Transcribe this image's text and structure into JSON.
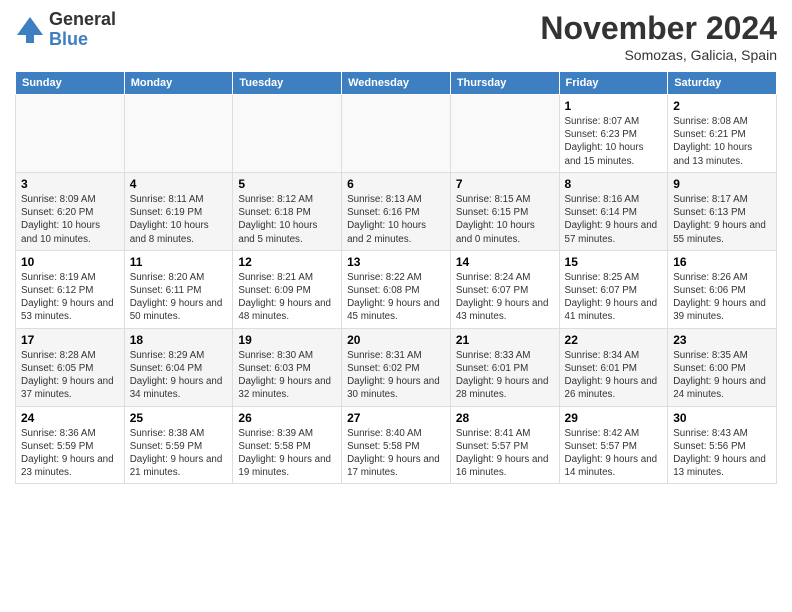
{
  "logo": {
    "general": "General",
    "blue": "Blue"
  },
  "header": {
    "month": "November 2024",
    "location": "Somozas, Galicia, Spain"
  },
  "weekdays": [
    "Sunday",
    "Monday",
    "Tuesday",
    "Wednesday",
    "Thursday",
    "Friday",
    "Saturday"
  ],
  "weeks": [
    [
      {
        "day": "",
        "info": ""
      },
      {
        "day": "",
        "info": ""
      },
      {
        "day": "",
        "info": ""
      },
      {
        "day": "",
        "info": ""
      },
      {
        "day": "",
        "info": ""
      },
      {
        "day": "1",
        "info": "Sunrise: 8:07 AM\nSunset: 6:23 PM\nDaylight: 10 hours and 15 minutes."
      },
      {
        "day": "2",
        "info": "Sunrise: 8:08 AM\nSunset: 6:21 PM\nDaylight: 10 hours and 13 minutes."
      }
    ],
    [
      {
        "day": "3",
        "info": "Sunrise: 8:09 AM\nSunset: 6:20 PM\nDaylight: 10 hours and 10 minutes."
      },
      {
        "day": "4",
        "info": "Sunrise: 8:11 AM\nSunset: 6:19 PM\nDaylight: 10 hours and 8 minutes."
      },
      {
        "day": "5",
        "info": "Sunrise: 8:12 AM\nSunset: 6:18 PM\nDaylight: 10 hours and 5 minutes."
      },
      {
        "day": "6",
        "info": "Sunrise: 8:13 AM\nSunset: 6:16 PM\nDaylight: 10 hours and 2 minutes."
      },
      {
        "day": "7",
        "info": "Sunrise: 8:15 AM\nSunset: 6:15 PM\nDaylight: 10 hours and 0 minutes."
      },
      {
        "day": "8",
        "info": "Sunrise: 8:16 AM\nSunset: 6:14 PM\nDaylight: 9 hours and 57 minutes."
      },
      {
        "day": "9",
        "info": "Sunrise: 8:17 AM\nSunset: 6:13 PM\nDaylight: 9 hours and 55 minutes."
      }
    ],
    [
      {
        "day": "10",
        "info": "Sunrise: 8:19 AM\nSunset: 6:12 PM\nDaylight: 9 hours and 53 minutes."
      },
      {
        "day": "11",
        "info": "Sunrise: 8:20 AM\nSunset: 6:11 PM\nDaylight: 9 hours and 50 minutes."
      },
      {
        "day": "12",
        "info": "Sunrise: 8:21 AM\nSunset: 6:09 PM\nDaylight: 9 hours and 48 minutes."
      },
      {
        "day": "13",
        "info": "Sunrise: 8:22 AM\nSunset: 6:08 PM\nDaylight: 9 hours and 45 minutes."
      },
      {
        "day": "14",
        "info": "Sunrise: 8:24 AM\nSunset: 6:07 PM\nDaylight: 9 hours and 43 minutes."
      },
      {
        "day": "15",
        "info": "Sunrise: 8:25 AM\nSunset: 6:07 PM\nDaylight: 9 hours and 41 minutes."
      },
      {
        "day": "16",
        "info": "Sunrise: 8:26 AM\nSunset: 6:06 PM\nDaylight: 9 hours and 39 minutes."
      }
    ],
    [
      {
        "day": "17",
        "info": "Sunrise: 8:28 AM\nSunset: 6:05 PM\nDaylight: 9 hours and 37 minutes."
      },
      {
        "day": "18",
        "info": "Sunrise: 8:29 AM\nSunset: 6:04 PM\nDaylight: 9 hours and 34 minutes."
      },
      {
        "day": "19",
        "info": "Sunrise: 8:30 AM\nSunset: 6:03 PM\nDaylight: 9 hours and 32 minutes."
      },
      {
        "day": "20",
        "info": "Sunrise: 8:31 AM\nSunset: 6:02 PM\nDaylight: 9 hours and 30 minutes."
      },
      {
        "day": "21",
        "info": "Sunrise: 8:33 AM\nSunset: 6:01 PM\nDaylight: 9 hours and 28 minutes."
      },
      {
        "day": "22",
        "info": "Sunrise: 8:34 AM\nSunset: 6:01 PM\nDaylight: 9 hours and 26 minutes."
      },
      {
        "day": "23",
        "info": "Sunrise: 8:35 AM\nSunset: 6:00 PM\nDaylight: 9 hours and 24 minutes."
      }
    ],
    [
      {
        "day": "24",
        "info": "Sunrise: 8:36 AM\nSunset: 5:59 PM\nDaylight: 9 hours and 23 minutes."
      },
      {
        "day": "25",
        "info": "Sunrise: 8:38 AM\nSunset: 5:59 PM\nDaylight: 9 hours and 21 minutes."
      },
      {
        "day": "26",
        "info": "Sunrise: 8:39 AM\nSunset: 5:58 PM\nDaylight: 9 hours and 19 minutes."
      },
      {
        "day": "27",
        "info": "Sunrise: 8:40 AM\nSunset: 5:58 PM\nDaylight: 9 hours and 17 minutes."
      },
      {
        "day": "28",
        "info": "Sunrise: 8:41 AM\nSunset: 5:57 PM\nDaylight: 9 hours and 16 minutes."
      },
      {
        "day": "29",
        "info": "Sunrise: 8:42 AM\nSunset: 5:57 PM\nDaylight: 9 hours and 14 minutes."
      },
      {
        "day": "30",
        "info": "Sunrise: 8:43 AM\nSunset: 5:56 PM\nDaylight: 9 hours and 13 minutes."
      }
    ]
  ]
}
